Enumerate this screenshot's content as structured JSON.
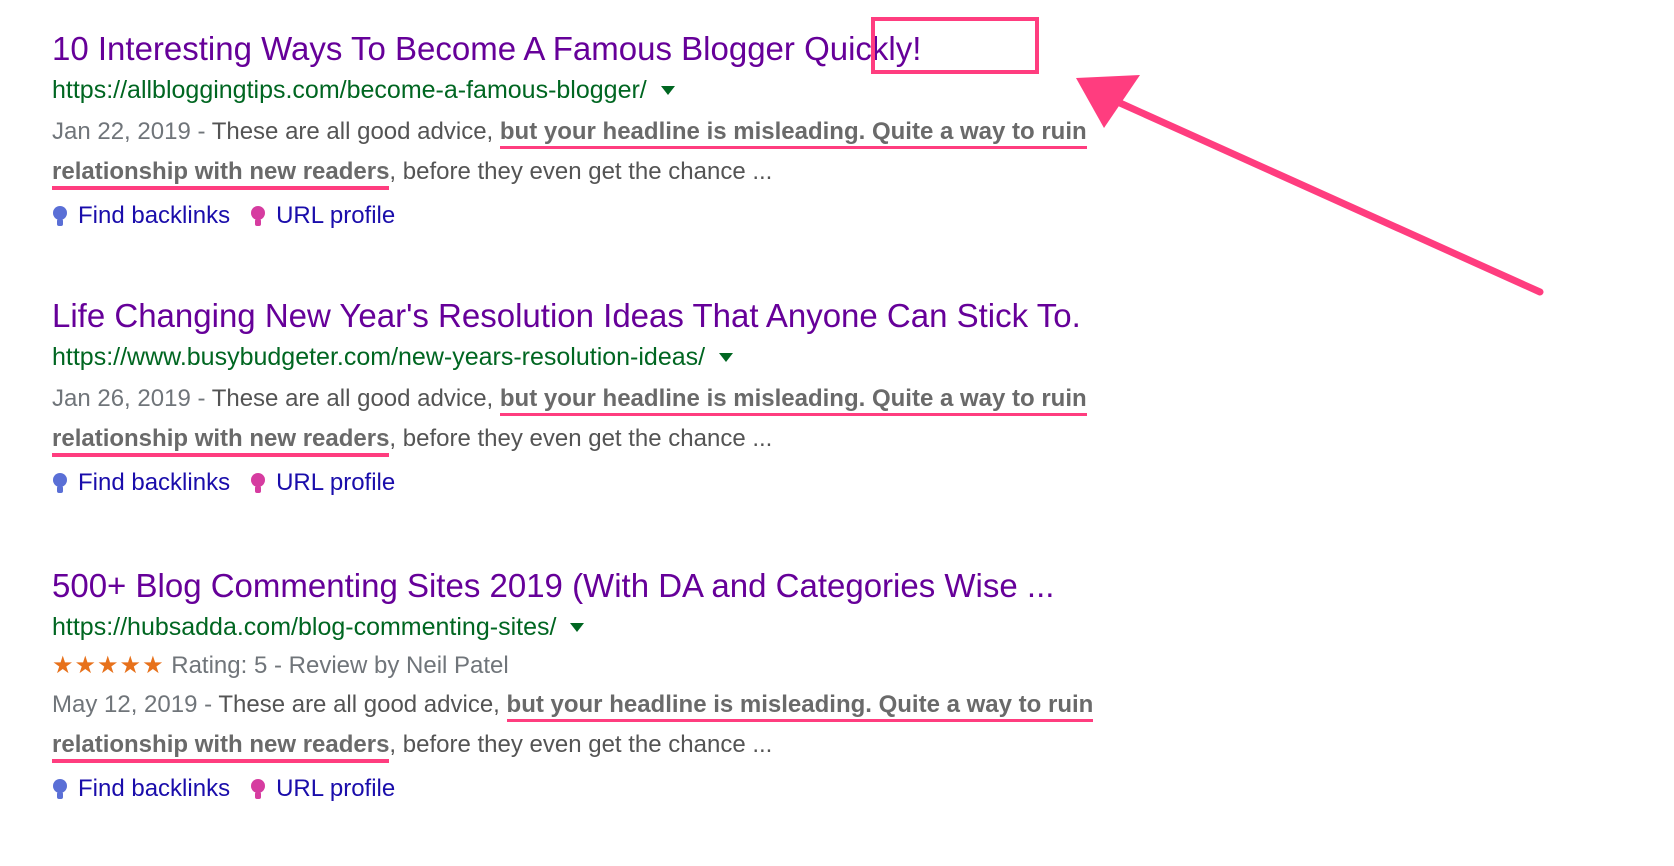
{
  "results": [
    {
      "title_main": "10 Interesting Ways To Become A Famous Blogger",
      "title_emph": "Quickly!",
      "url": "https://allbloggingtips.com/become-a-famous-blogger/",
      "date": "Jan 22, 2019",
      "sep": " - ",
      "lead": "These are all good advice, ",
      "hl1": "but your headline is misleading. Quite a way to ruin",
      "hl2": "relationship with new readers",
      "tail": ", before they even get the chance ...",
      "backlinks": "Find backlinks",
      "profile": "URL profile"
    },
    {
      "title": "Life Changing New Year's Resolution Ideas That Anyone Can Stick To.",
      "url": "https://www.busybudgeter.com/new-years-resolution-ideas/",
      "date": "Jan 26, 2019",
      "sep": " - ",
      "lead": "These are all good advice, ",
      "hl1": "but your headline is misleading. Quite a way to ruin",
      "hl2": "relationship with new readers",
      "tail": ", before they even get the chance ...",
      "backlinks": "Find backlinks",
      "profile": "URL profile"
    },
    {
      "title": "500+ Blog Commenting Sites 2019 (With DA and Categories Wise ...",
      "url": "https://hubsadda.com/blog-commenting-sites/",
      "stars": "★★★★★",
      "rating_text": "Rating: 5 - Review by Neil Patel",
      "rating_value": 5,
      "date": "May 12, 2019",
      "sep": " - ",
      "lead": "These are all good advice, ",
      "hl1": "but your headline is misleading. Quite a way to ruin",
      "hl2": "relationship with new readers",
      "tail": ", before they even get the chance ...",
      "backlinks": "Find backlinks",
      "profile": "URL profile"
    }
  ],
  "icons": {
    "backlinks": "backlinks-icon",
    "profile": "url-profile-icon",
    "dropdown": "dropdown-arrow-icon"
  },
  "colors": {
    "title": "#660099",
    "url": "#006621",
    "link": "#1a0dab",
    "annotation": "#ff3d7f",
    "stars": "#e7711b",
    "backlinks_icon": "#5a6fd6",
    "profile_icon": "#d63ca0"
  }
}
